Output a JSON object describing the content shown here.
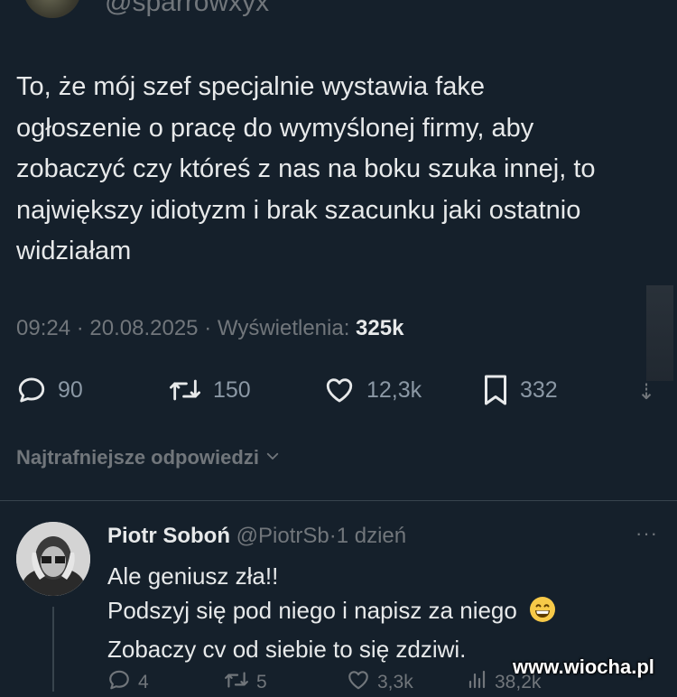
{
  "header": {
    "handle": "@sparrowxyx"
  },
  "tweet": {
    "text": "To, że mój szef specjalnie wystawia fake\nogłoszenie o pracę do wymyślonej firmy, aby\nzobaczyć czy któreś z nas na boku szuka innej, to\nnajwiększy idiotyzm i brak szacunku jaki ostatnio\nwidziałam",
    "time": "09:24",
    "date": "20.08.2025",
    "separator": "·",
    "views_label": "Wyświetlenia:",
    "views_count": "325k"
  },
  "actions": {
    "replies": "90",
    "reposts": "150",
    "likes": "12,3k",
    "bookmarks": "332"
  },
  "replies_section": {
    "label": "Najtrafniejsze odpowiedzi"
  },
  "reply": {
    "name": "Piotr Soboń",
    "handle": "@PiotrSb",
    "separator": "·",
    "time": "1 dzień",
    "more": "···",
    "lines": [
      "Ale geniusz zła!!",
      "Podszyj się pod niego i napisz za niego",
      "Zobaczy cv od siebie to się zdziwi."
    ],
    "emoji": "grinning-face",
    "actions": {
      "replies": "4",
      "reposts": "5",
      "likes": "3,3k",
      "views": "38,2k"
    }
  },
  "watermark": "www.wiocha.pl",
  "colors": {
    "background": "#15202b",
    "text": "#e7e9ea",
    "muted": "#71767b",
    "divider": "#38444d"
  }
}
